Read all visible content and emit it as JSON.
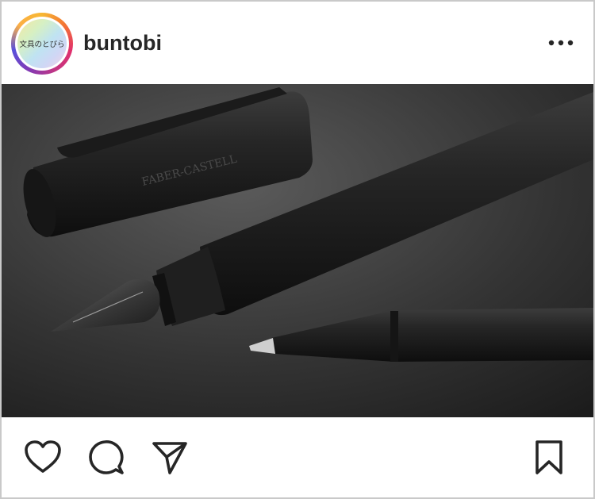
{
  "post": {
    "username": "buntobi",
    "avatar": {
      "text": "文具のとびら",
      "ring_colors": [
        "#f7b733",
        "#e1306c",
        "#833ab4"
      ]
    },
    "more_icon": "more-horizontal-icon",
    "image": {
      "label": "FABER-CASTELL"
    },
    "actions": {
      "like_icon": "heart-icon",
      "comment_icon": "comment-icon",
      "share_icon": "send-icon",
      "save_icon": "bookmark-icon"
    }
  },
  "colors": {
    "text": "#262626",
    "border": "#c9c9c9"
  }
}
